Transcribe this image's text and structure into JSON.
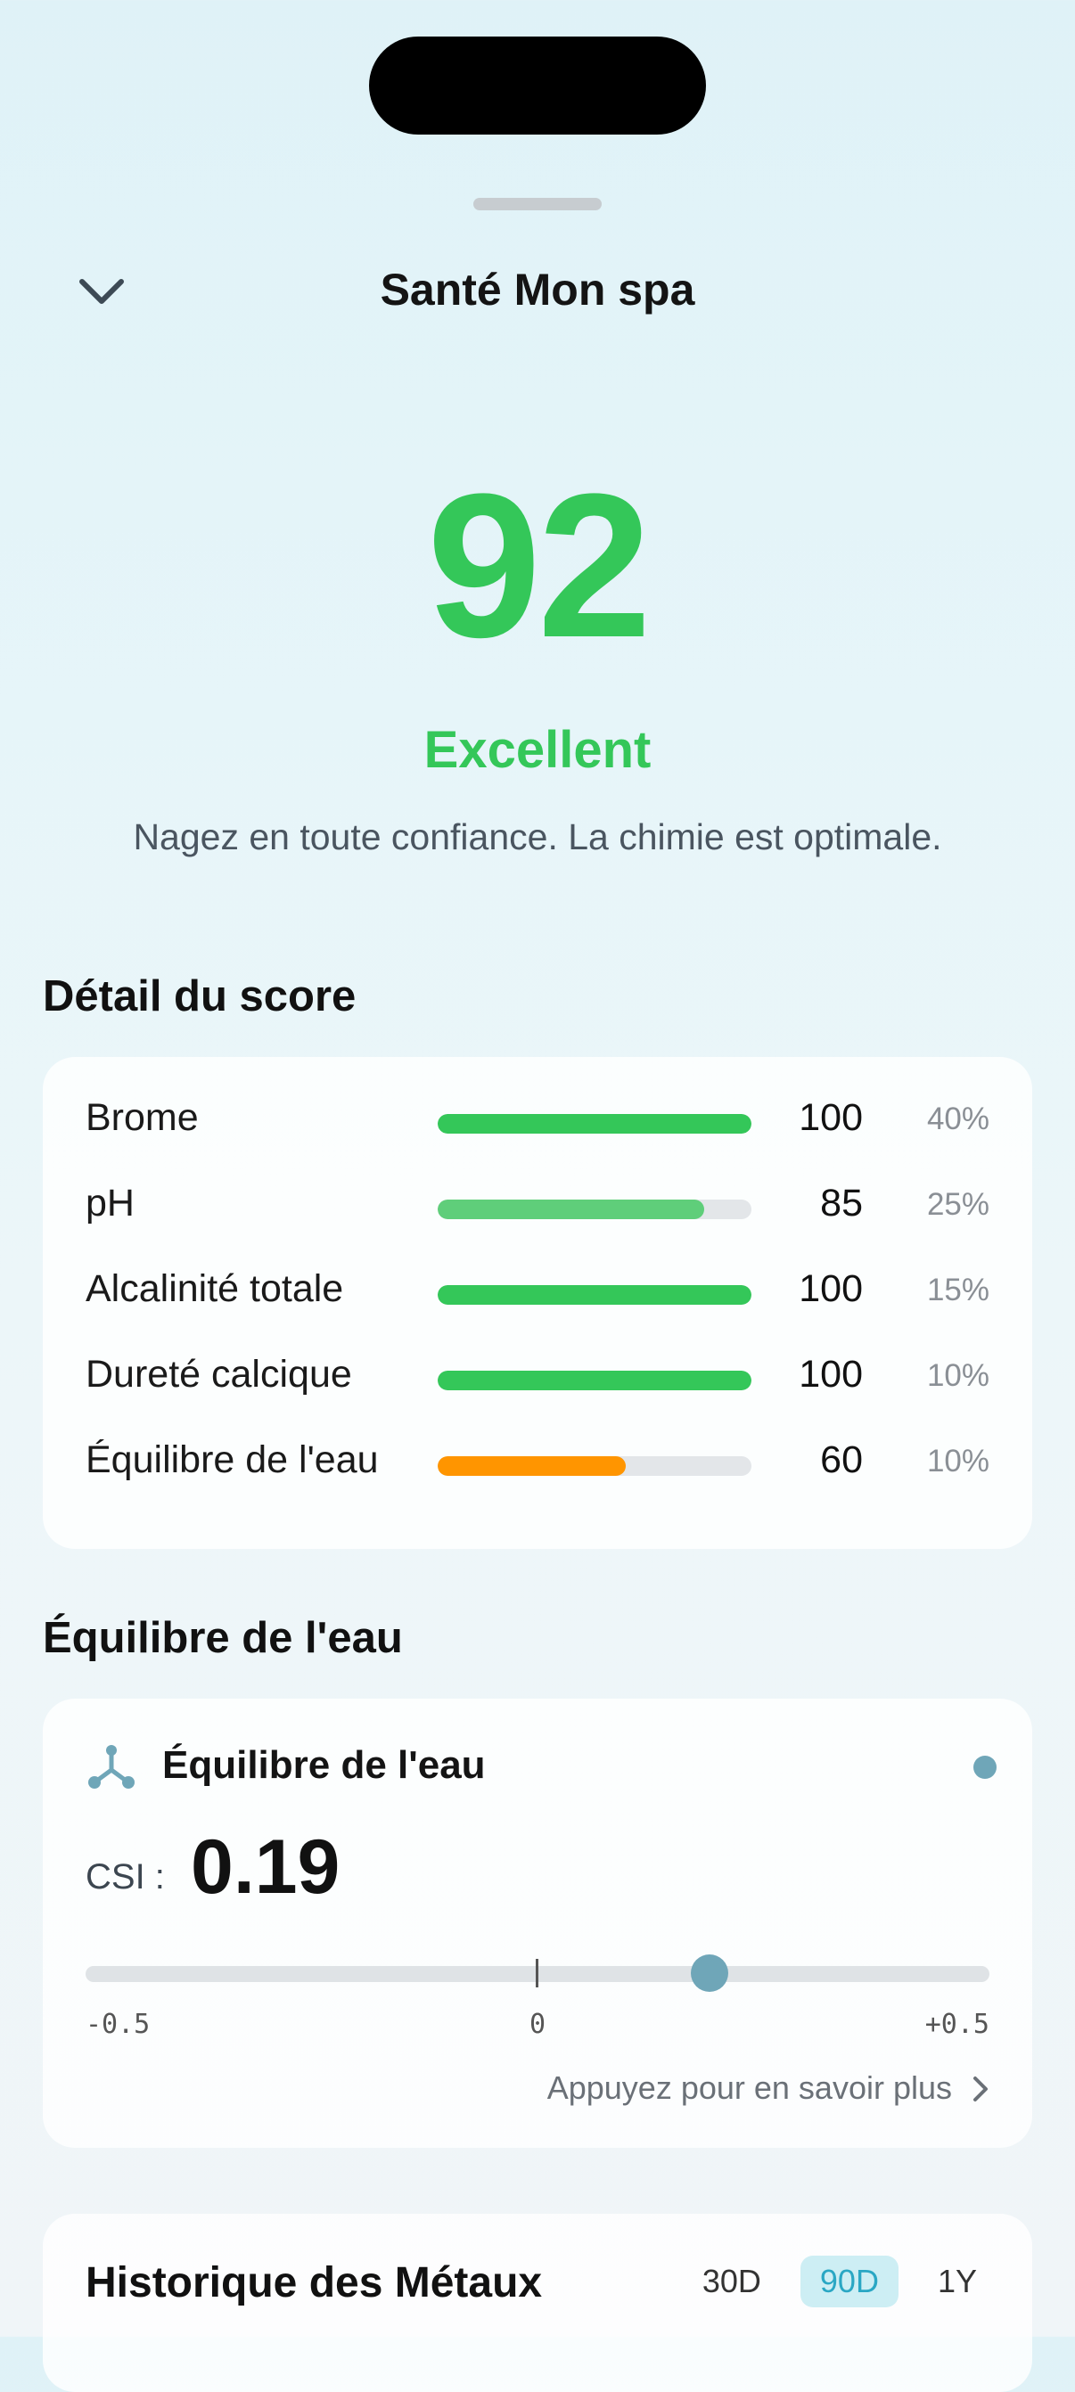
{
  "header": {
    "title": "Santé Mon spa"
  },
  "health": {
    "score": "92",
    "rating": "Excellent",
    "message": "Nagez en toute confiance. La chimie est optimale."
  },
  "score_detail": {
    "heading": "Détail du score",
    "rows": [
      {
        "label": "Brome",
        "score": "100",
        "weight": "40%",
        "fill": 1.0,
        "color": "#34c759"
      },
      {
        "label": "pH",
        "score": "85",
        "weight": "25%",
        "fill": 0.85,
        "color": "#5fce7a"
      },
      {
        "label": "Alcalinité totale",
        "score": "100",
        "weight": "15%",
        "fill": 1.0,
        "color": "#34c759"
      },
      {
        "label": "Dureté calcique",
        "score": "100",
        "weight": "10%",
        "fill": 1.0,
        "color": "#34c759"
      },
      {
        "label": "Équilibre de l'eau",
        "score": "60",
        "weight": "10%",
        "fill": 0.6,
        "color": "#ff9500"
      }
    ]
  },
  "water_balance": {
    "heading": "Équilibre de l'eau",
    "card_title": "Équilibre de l'eau",
    "csi_label": "CSI :",
    "csi_value": "0.19",
    "scale_min": "-0.5",
    "scale_mid": "0",
    "scale_max": "+0.5",
    "learn_more": "Appuyez pour en savoir plus",
    "accent_color": "#6fa6b8"
  },
  "metals_history": {
    "title": "Historique des Métaux",
    "ranges": [
      "30D",
      "90D",
      "1Y"
    ],
    "selected_range": "90D"
  }
}
